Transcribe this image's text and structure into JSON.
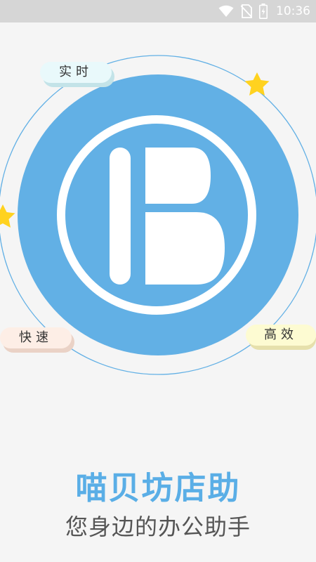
{
  "status_bar": {
    "time": "10:36",
    "icons": [
      "wifi-icon",
      "no-sim-icon",
      "battery-charging-icon"
    ]
  },
  "splash": {
    "logo_icon": "b-logo-icon",
    "tags": {
      "realtime": "实时",
      "fast": "快速",
      "efficient": "高效"
    },
    "title": "喵贝坊店助",
    "subtitle": "您身边的办公助手"
  },
  "colors": {
    "brand_blue": "#5aaee6",
    "ring_blue": "#62b0e5",
    "star_yellow": "#ffd21f",
    "tag_cyan": "#e9f9fb",
    "tag_peach": "#fdeee6",
    "tag_yellow": "#fdfbd2"
  }
}
